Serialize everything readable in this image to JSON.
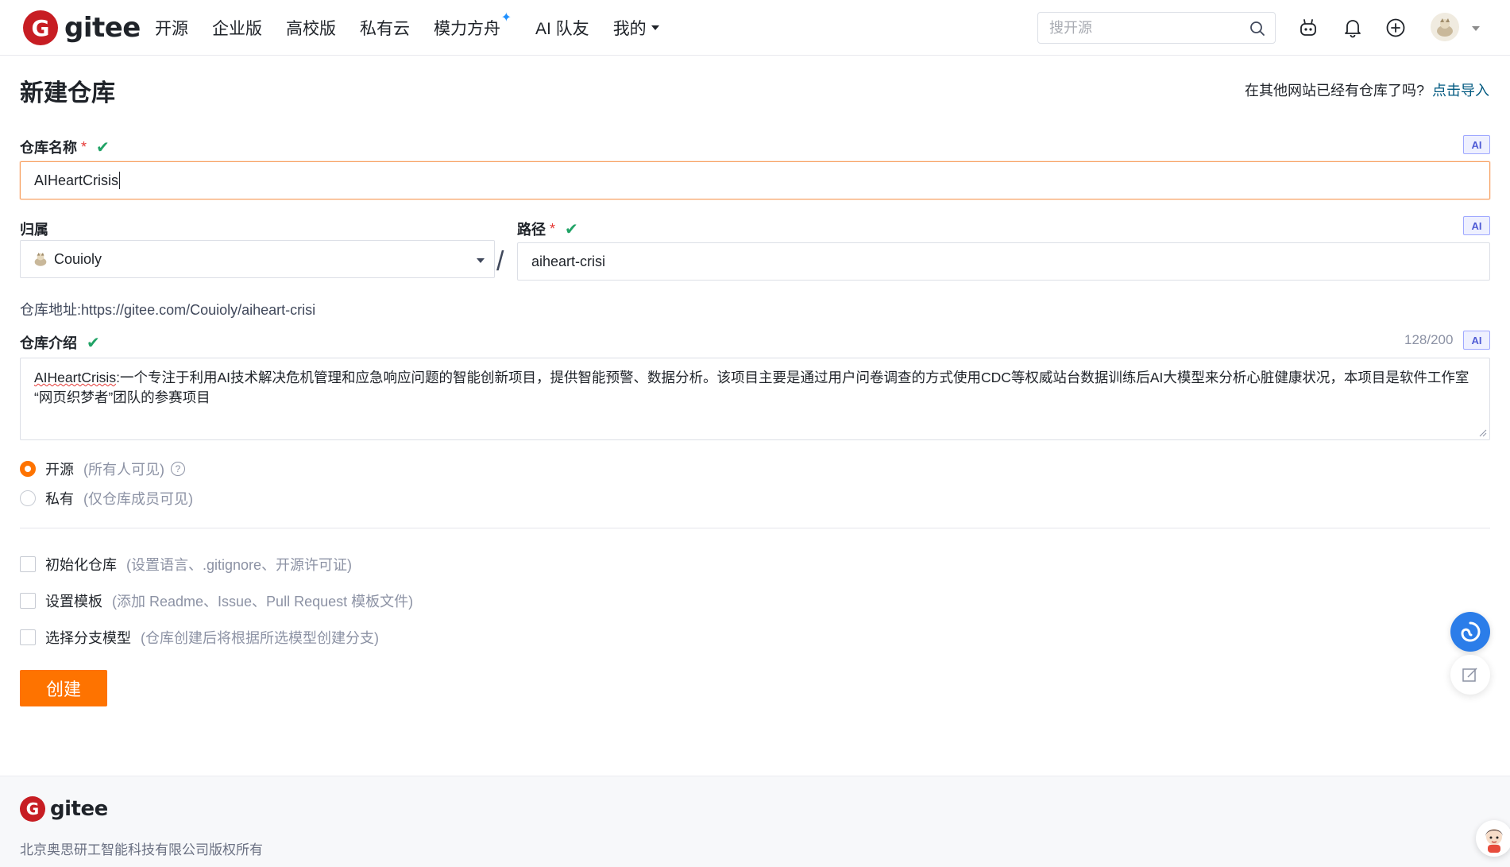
{
  "header": {
    "logo_mark": "G",
    "logo_text": "gitee",
    "nav": [
      {
        "label": "开源"
      },
      {
        "label": "企业版"
      },
      {
        "label": "高校版"
      },
      {
        "label": "私有云"
      },
      {
        "label": "模力方舟"
      },
      {
        "label": "AI 队友"
      },
      {
        "label": "我的"
      }
    ],
    "search_placeholder": "搜开源"
  },
  "page": {
    "title": "新建仓库",
    "import_prompt": "在其他网站已经有仓库了吗?",
    "import_link": "点击导入"
  },
  "form": {
    "name_label": "仓库名称",
    "name_value": "AIHeartCrisis",
    "owner_label": "归属",
    "owner_value": "Couioly",
    "path_label": "路径",
    "path_value": "aiheart-crisi",
    "separator": "/",
    "repo_url_label": "仓库地址:",
    "repo_url_value": "https://gitee.com/Couioly/aiheart-crisi",
    "desc_label": "仓库介绍",
    "desc_counter": "128/200",
    "desc_name": "AIHeartCrisis",
    "desc_line1_rest": ":一个专注于利用AI技术解决危机管理和应急响应问题的智能创新项目，提供智能预警、数据分析。该项目主要是通过用户问卷调查的方式使用CDC等权威站台数据训练后AI大模型来分析心脏健康状况，本项目是软件工作室",
    "desc_line2": "“网页织梦者”团队的参赛项目",
    "ai_badge": "AI",
    "required_mark": "*",
    "check_mark": "✔"
  },
  "visibility": [
    {
      "label": "开源",
      "hint": "(所有人可见)",
      "selected": true
    },
    {
      "label": "私有",
      "hint": "(仅仓库成员可见)",
      "selected": false
    }
  ],
  "options": [
    {
      "label": "初始化仓库",
      "hint": "(设置语言、.gitignore、开源许可证)"
    },
    {
      "label": "设置模板",
      "hint": "(添加 Readme、Issue、Pull Request 模板文件)"
    },
    {
      "label": "选择分支模型",
      "hint": "(仓库创建后将根据所选模型创建分支)"
    }
  ],
  "create_button": "创建",
  "footer": {
    "logo_text": "gitee",
    "copyright": "北京奥思研工智能科技有限公司版权所有"
  },
  "colors": {
    "brand_red": "#c71d23",
    "accent_orange": "#fe7300",
    "link_blue": "#005980",
    "check_green": "#21a366"
  }
}
